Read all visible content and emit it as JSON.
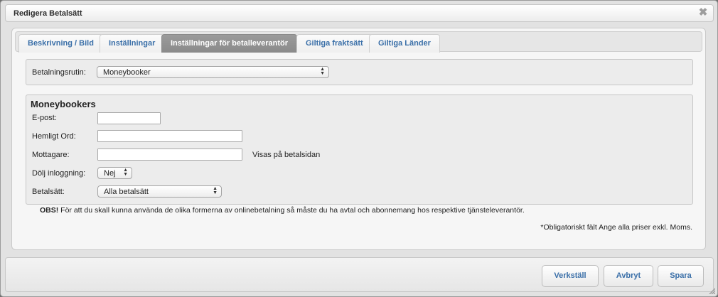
{
  "dialog": {
    "title": "Redigera Betalsätt",
    "close_glyph": "✖"
  },
  "tabs": [
    {
      "label": "Beskrivning / Bild",
      "active": false
    },
    {
      "label": "Inställningar",
      "active": false
    },
    {
      "label": "Inställningar för betalleverantör",
      "active": true
    },
    {
      "label": "Giltiga fraktsätt",
      "active": false
    },
    {
      "label": "Giltiga Länder",
      "active": false
    }
  ],
  "routine": {
    "label": "Betalningsrutin:",
    "selected": "Moneybooker"
  },
  "provider": {
    "title": "Moneybookers",
    "fields": {
      "email": {
        "label": "E-post:",
        "value": ""
      },
      "secret": {
        "label": "Hemligt Ord:",
        "value": ""
      },
      "recipient": {
        "label": "Mottagare:",
        "value": "",
        "hint": "Visas på betalsidan"
      },
      "hide_login": {
        "label": "Dölj inloggning:",
        "selected": "Nej"
      },
      "payment_methods": {
        "label": "Betalsätt:",
        "selected": "Alla betalsätt"
      }
    }
  },
  "notice": {
    "prefix": "OBS!",
    "text": " För att du skall kunna använda de olika formerna av onlinebetalning så måste du ha avtal och abonnemang hos respektive tjänsteleverantör."
  },
  "footnote": "*Obligatoriskt fält Ange alla priser exkl. Moms.",
  "buttons": {
    "apply": "Verkställ",
    "cancel": "Avbryt",
    "save": "Spara"
  },
  "icons": {
    "close": "close-icon",
    "select_arrows": "select-arrows-icon",
    "resize": "resize-grip-icon"
  }
}
